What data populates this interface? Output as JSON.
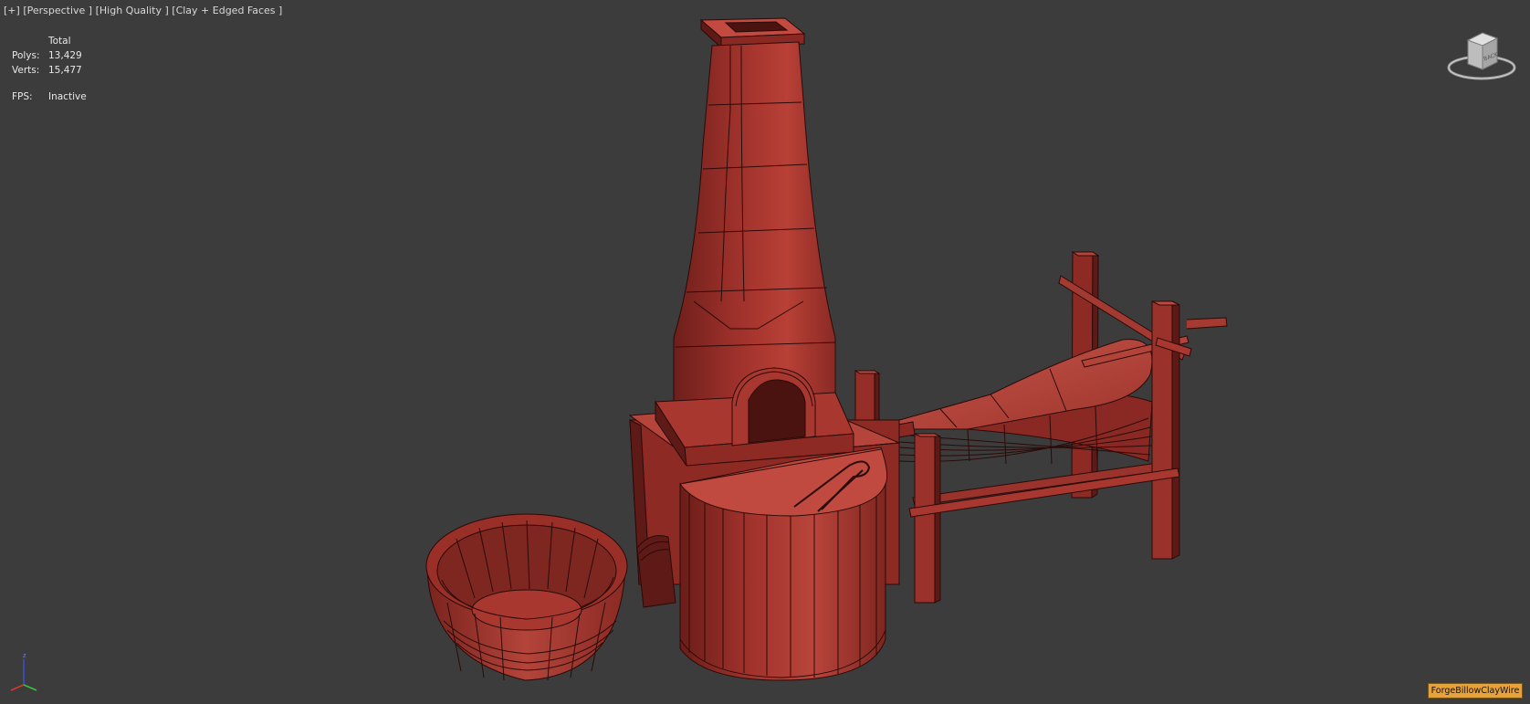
{
  "viewport": {
    "label_plus": "[+]",
    "label_view": "[Perspective ]",
    "label_quality": "[High Quality ]",
    "label_shading": "[Clay + Edged Faces ]"
  },
  "stats": {
    "header": "Total",
    "polys_label": "Polys:",
    "polys_value": "13,429",
    "verts_label": "Verts:",
    "verts_value": "15,477",
    "fps_label": "FPS:",
    "fps_value": "Inactive"
  },
  "viewcube": {
    "face_label": "BACK"
  },
  "axis": {
    "z": "z"
  },
  "file_label": "ForgeBillowClayWire",
  "colors": {
    "background": "#3c3c3c",
    "clay": "#a8362f",
    "clay_light": "#c24a40",
    "clay_dark": "#6e1f1b",
    "edge": "#2a0a08",
    "file_label_bg": "#e8a23a"
  }
}
